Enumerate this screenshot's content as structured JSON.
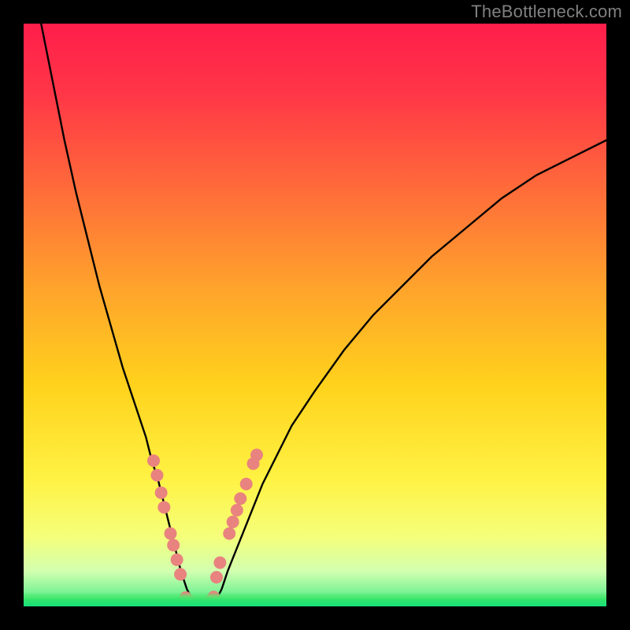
{
  "watermark": "TheBottleneck.com",
  "chart_data": {
    "type": "line",
    "title": "",
    "xlabel": "",
    "ylabel": "",
    "xlim": [
      0,
      100
    ],
    "ylim": [
      0,
      100
    ],
    "x": [
      3,
      5,
      7,
      9,
      11,
      13,
      15,
      17,
      19,
      21,
      22,
      23,
      24,
      25,
      26,
      27,
      28,
      29,
      30,
      31,
      32,
      33,
      34,
      35,
      37,
      39,
      41,
      43,
      46,
      50,
      55,
      60,
      65,
      70,
      76,
      82,
      88,
      94,
      100
    ],
    "y": [
      100,
      90,
      80,
      71,
      63,
      55,
      48,
      41,
      35,
      29,
      25,
      22,
      18,
      14,
      10,
      6,
      3,
      1,
      0,
      0,
      0,
      1,
      3,
      6,
      11,
      16,
      21,
      25,
      31,
      37,
      44,
      50,
      55,
      60,
      65,
      70,
      74,
      77,
      80
    ],
    "gradient_stops": [
      {
        "pos": 0.0,
        "color": "#ff1e4b"
      },
      {
        "pos": 0.12,
        "color": "#ff3647"
      },
      {
        "pos": 0.28,
        "color": "#ff6a3a"
      },
      {
        "pos": 0.45,
        "color": "#ffa22c"
      },
      {
        "pos": 0.62,
        "color": "#ffd21c"
      },
      {
        "pos": 0.78,
        "color": "#fff243"
      },
      {
        "pos": 0.88,
        "color": "#f5ff7a"
      },
      {
        "pos": 0.94,
        "color": "#d2ffb0"
      },
      {
        "pos": 0.975,
        "color": "#7ef396"
      },
      {
        "pos": 1.0,
        "color": "#17e07a"
      }
    ],
    "markers_left": [
      {
        "x": 22.3,
        "y": 25.0
      },
      {
        "x": 22.9,
        "y": 22.5
      },
      {
        "x": 23.6,
        "y": 19.5
      },
      {
        "x": 24.1,
        "y": 17.0
      },
      {
        "x": 25.2,
        "y": 12.5
      },
      {
        "x": 25.7,
        "y": 10.5
      },
      {
        "x": 26.3,
        "y": 8.0
      },
      {
        "x": 26.9,
        "y": 5.5
      }
    ],
    "markers_right": [
      {
        "x": 33.1,
        "y": 5.0
      },
      {
        "x": 33.7,
        "y": 7.5
      },
      {
        "x": 35.3,
        "y": 12.5
      },
      {
        "x": 35.9,
        "y": 14.5
      },
      {
        "x": 36.6,
        "y": 16.5
      },
      {
        "x": 37.2,
        "y": 18.5
      },
      {
        "x": 38.2,
        "y": 21.0
      },
      {
        "x": 39.4,
        "y": 24.5
      },
      {
        "x": 40.0,
        "y": 26.0
      }
    ],
    "markers_bottom": [
      {
        "x": 27.8,
        "y": 1.5
      },
      {
        "x": 28.6,
        "y": 0.8
      },
      {
        "x": 29.4,
        "y": 0.4
      },
      {
        "x": 30.2,
        "y": 0.3
      },
      {
        "x": 31.0,
        "y": 0.4
      },
      {
        "x": 31.8,
        "y": 0.8
      },
      {
        "x": 32.6,
        "y": 1.6
      }
    ],
    "marker_color": "#e9837f",
    "marker_radius_px": 8
  }
}
